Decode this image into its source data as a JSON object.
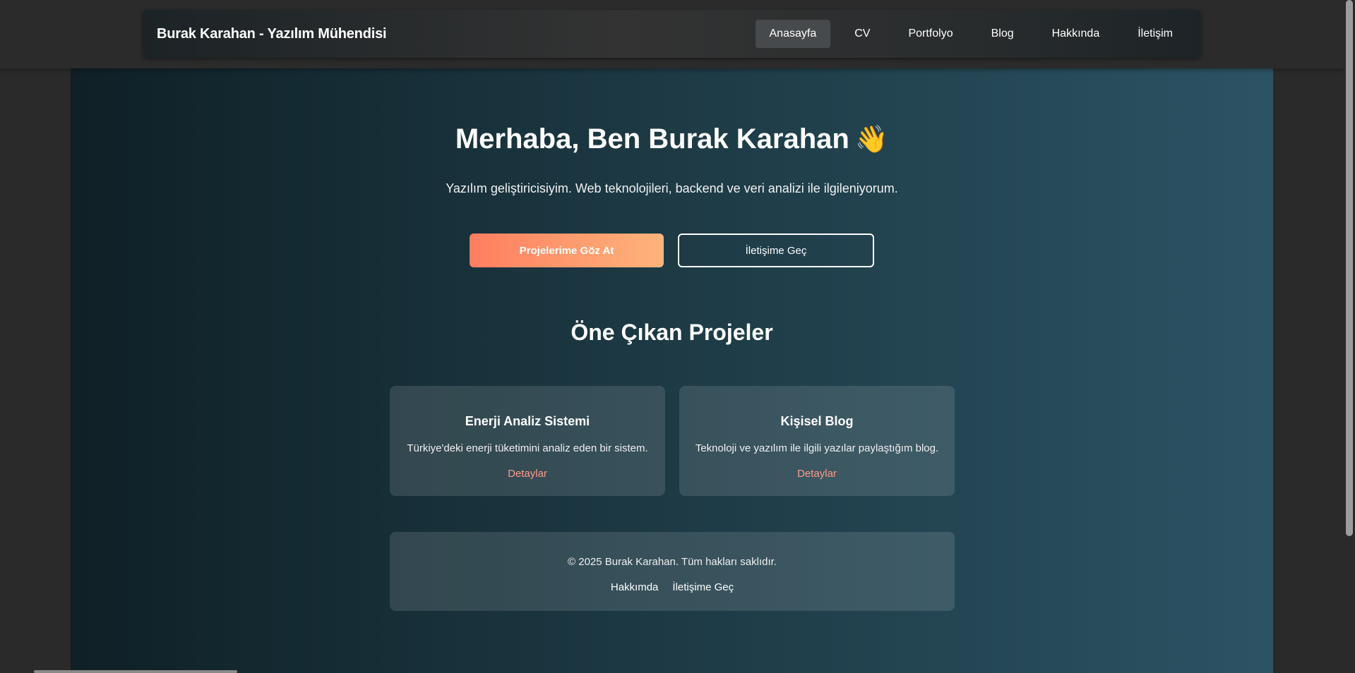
{
  "header": {
    "brand": "Burak Karahan - Yazılım Mühendisi",
    "nav": [
      {
        "label": "Anasayfa",
        "active": true
      },
      {
        "label": "CV",
        "active": false
      },
      {
        "label": "Portfolyo",
        "active": false
      },
      {
        "label": "Blog",
        "active": false
      },
      {
        "label": "Hakkında",
        "active": false
      },
      {
        "label": "İletişim",
        "active": false
      }
    ]
  },
  "hero": {
    "title": "Merhaba, Ben Burak Karahan",
    "emoji": "👋",
    "subtitle": "Yazılım geliştiricisiyim. Web teknolojileri, backend ve veri analizi ile ilgileniyorum.",
    "primary_button": "Projelerime Göz At",
    "secondary_button": "İletişime Geç"
  },
  "projects": {
    "title": "Öne Çıkan Projeler",
    "items": [
      {
        "title": "Enerji Analiz Sistemi",
        "description": "Türkiye'deki enerji tüketimini analiz eden bir sistem.",
        "link": "Detaylar"
      },
      {
        "title": "Kişisel Blog",
        "description": "Teknoloji ve yazılım ile ilgili yazılar paylaştığım blog.",
        "link": "Detaylar"
      }
    ]
  },
  "footer": {
    "copyright": "© 2025 Burak Karahan. Tüm hakları saklıdır.",
    "links": [
      "Hakkımda",
      "İletişime Geç"
    ]
  },
  "colors": {
    "accent_gradient_start": "#ff7e5f",
    "accent_gradient_end": "#feb47b",
    "link_color": "#ff9a8b",
    "bg_gradient_start": "#0f2026",
    "bg_gradient_end": "#2c5364"
  }
}
